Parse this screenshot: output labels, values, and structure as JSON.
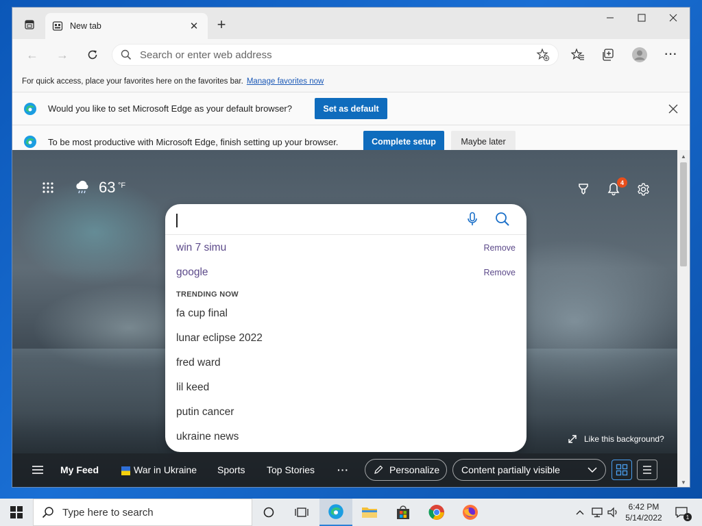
{
  "browser": {
    "tab_title": "New tab",
    "omnibox_placeholder": "Search or enter web address",
    "favorites_bar": {
      "text": "For quick access, place your favorites here on the favorites bar.",
      "link": "Manage favorites now"
    },
    "default_prompt": {
      "text": "Would you like to set Microsoft Edge as your default browser?",
      "button": "Set as default"
    },
    "setup_prompt": {
      "text": "To be most productive with Microsoft Edge, finish setting up your browser.",
      "primary": "Complete setup",
      "secondary": "Maybe later"
    }
  },
  "ntp": {
    "weather": {
      "temp": "63",
      "unit": "°F"
    },
    "notification_count": "4",
    "search": {
      "history": [
        {
          "text": "win 7 simu",
          "action": "Remove"
        },
        {
          "text": "google",
          "action": "Remove"
        }
      ],
      "trending_label": "TRENDING NOW",
      "trending": [
        "fa cup final",
        "lunar eclipse 2022",
        "fred ward",
        "lil keed",
        "putin cancer",
        "ukraine news"
      ]
    },
    "like_background": "Like this background?",
    "feed": {
      "my_feed": "My Feed",
      "war_in_ukraine": "War in Ukraine",
      "sports": "Sports",
      "top_stories": "Top Stories",
      "more": "···",
      "personalize": "Personalize",
      "content_visibility": "Content partially visible"
    }
  },
  "taskbar": {
    "search_placeholder": "Type here to search",
    "time": "6:42 PM",
    "date": "5/14/2022",
    "notification_count": "1"
  },
  "colors": {
    "accent": "#0f6cbd",
    "history_link": "#5c4a8a",
    "badge": "#e94e1b"
  }
}
